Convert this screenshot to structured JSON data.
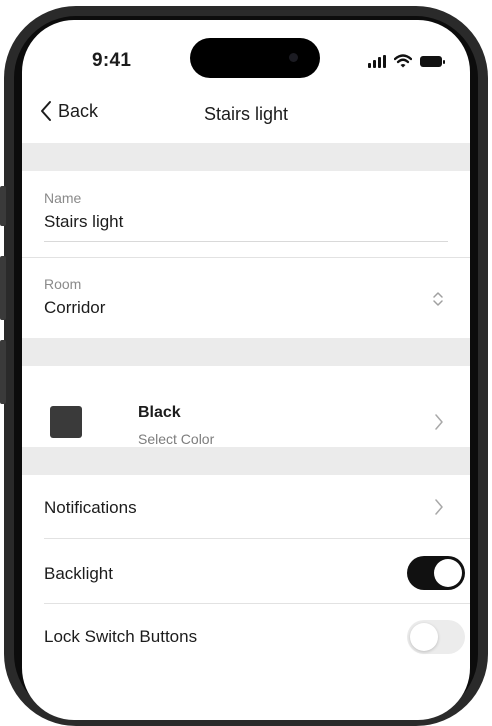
{
  "status_bar": {
    "time": "9:41"
  },
  "nav": {
    "back_label": "Back",
    "title": "Stairs light"
  },
  "name_field": {
    "label": "Name",
    "value": "Stairs light"
  },
  "room_field": {
    "label": "Room",
    "value": "Corridor"
  },
  "color_row": {
    "name": "Black",
    "subtitle": "Select Color",
    "swatch_color": "#3a3a3a"
  },
  "settings": [
    {
      "label": "Notifications",
      "type": "link"
    },
    {
      "label": "Backlight",
      "type": "toggle",
      "on": true
    },
    {
      "label": "Lock Switch Buttons",
      "type": "toggle",
      "on": false
    }
  ]
}
